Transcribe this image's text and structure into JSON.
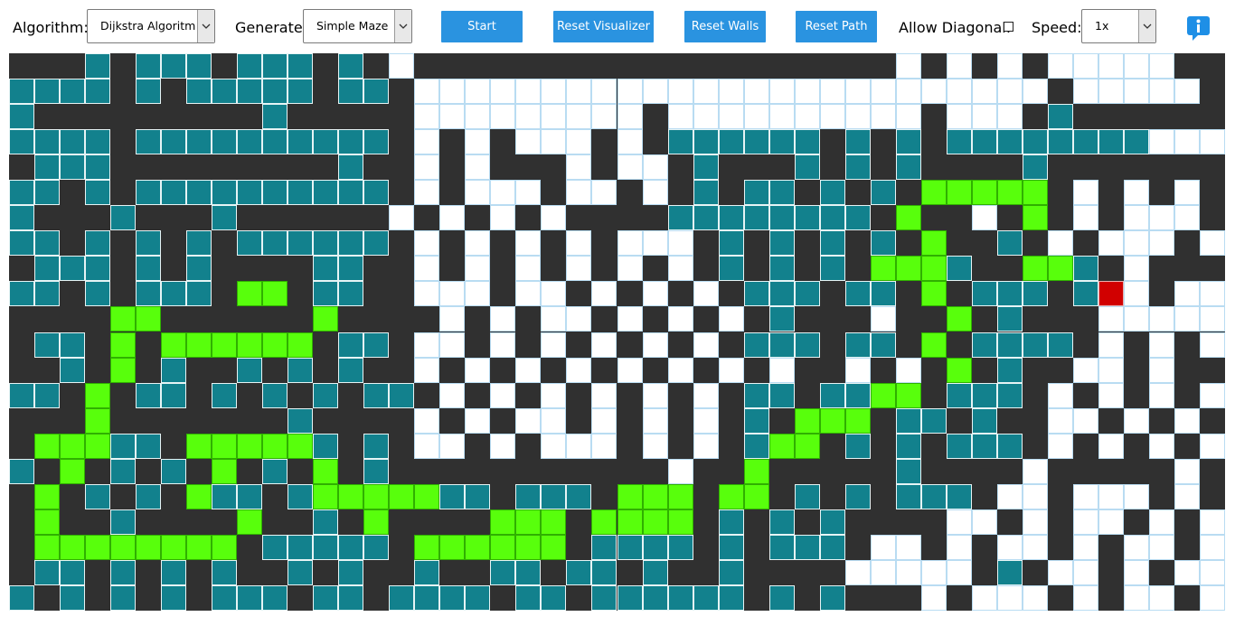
{
  "toolbar": {
    "algorithm_label": "Algorithm:",
    "algorithm_value": "Dijkstra Algoritm",
    "generate_label": "Generate:",
    "generate_value": "Simple Maze",
    "start_label": "Start",
    "reset_visualizer_label": "Reset Visualizer",
    "reset_walls_label": "Reset Walls",
    "reset_path_label": "Reset Path",
    "allow_diagonal_label": "Allow Diagonal:",
    "allow_diagonal_checked": false,
    "speed_label": "Speed:",
    "speed_value": "1x",
    "info_icon": "info-icon"
  },
  "legend": {
    "wall": "#303030",
    "open": "#ffffff",
    "visited": "#12818d",
    "path": "#58ff0c",
    "target": "#d10000"
  },
  "grid": {
    "columns": 48,
    "rows": 22,
    "key": "#=wall .=open v=visited p=path t=target",
    "cells": [
      "###v#vvv#vvv#v#.###################.#.#.#.....",
      "vvvv#v#vvvvv#vv#.........................#.....#.#...",
      "v#########v#####.........#..........#...#v###########",
      "vvvv#vvvvvvvvvv#.#.#...#.#vvvvvv#v#v#vvvvvvvv.....",
      "#vvv#########v##.#.###.#..#v###v#v#v####v#############",
      "vv#v#vvvvvvvvvv#.#...#..#.#v#vv#v#v#ppppp#.#.#.#.",
      "v###v###v######.#.#.#.####vvvvvvvv#p##.#p#.#...#.",
      "vv#v#v#v#vvvvvv#.#.#.#.#...#v#v#v#v#p##v#.#...#.#.",
      "#vvv#v#v####vv##.#.#.#.#.#.#v#v#v#pppv##ppv#.####.##",
      "vv#v#vvv#pp#vv##...#..#.#.#.#vvv#vv#p#vvv#vt.#...#..",
      "####pp######p####.#.#..#.#.#.#v###.##p#v###.....#.#..",
      "#vv#p#pppppp#vv#..#.#.#.#.#.#vvv#vv#p#vvvv#.#.#...#.",
      "##v#p#v##v#v#v##.#.#.#.#.#.#.#.##.#.#p#v##..#.##.##.",
      "vv#p#vv#v#v#v#vv#.#.#.#.#.#.#vv#vvpp#vvv#.#.#.#.#.",
      "###p#######v####.#.#..#.#.#.#v#ppp#vv#v##..#.#.#.#.",
      "#pppvv#pppppv#v#..#.#...#.#.#vpp#v#v#vvv#.#.#.#.#.",
      "v#p#v#v#p#v#p#v###########.##p#####v####.#####.###",
      "#p#v#v#pvv#vpppppvv#vvv#ppp#pp#v#v#vvv#..#...#.##.",
      "#p##v####p##v#p####ppp#pppp#v#v#v####..#.#..#.#.",
      "#pppppppp#vvvvv#pppppp#vvvv#v#vvv#..#.#..#.#..#.",
      "#vv#v#v#v##v#v##v##vv#vv#v##v####.....#v#..#.#..",
      "v#v#v#v#vvv#vv#vvvv#vv#vvvvvv#v#v###.#...#.#..#.#."
    ]
  }
}
